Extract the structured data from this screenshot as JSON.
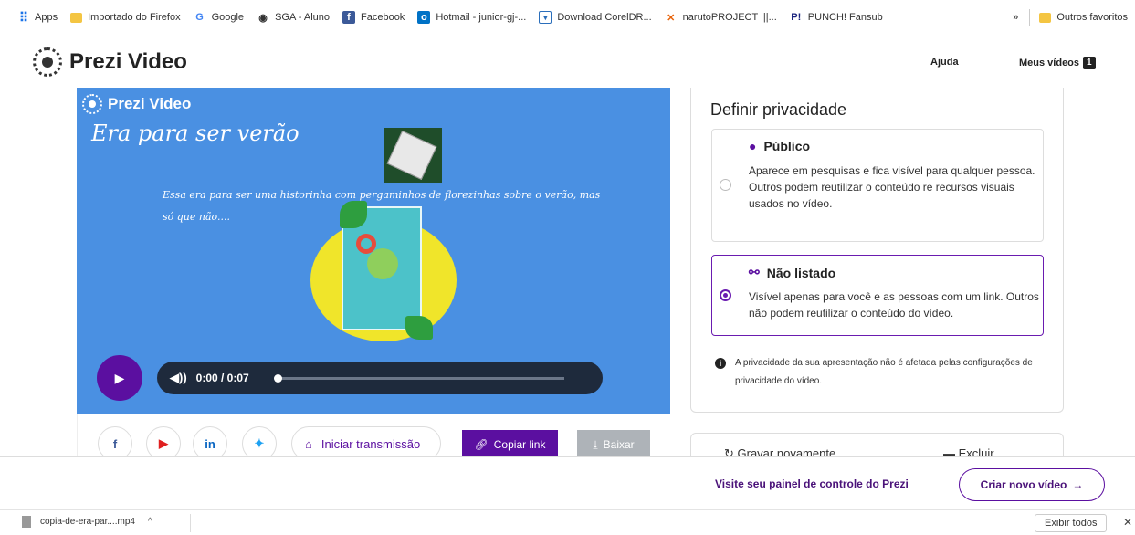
{
  "bookmarks": {
    "items": [
      {
        "label": "Apps",
        "icon": "apps-grid-icon"
      },
      {
        "label": "Importado do Firefox",
        "icon": "folder-icon"
      },
      {
        "label": "Google",
        "icon": "google-icon"
      },
      {
        "label": "SGA - Aluno",
        "icon": "globe-icon"
      },
      {
        "label": "Facebook",
        "icon": "facebook-icon"
      },
      {
        "label": "Hotmail - junior-gj-...",
        "icon": "outlook-icon"
      },
      {
        "label": "Download CorelDR...",
        "icon": "download-page-icon"
      },
      {
        "label": "narutoPROJECT |||...",
        "icon": "naruto-icon"
      },
      {
        "label": "PUNCH! Fansub",
        "icon": "punch-icon"
      }
    ],
    "more": "»",
    "other": "Outros favoritos"
  },
  "header": {
    "logo": "Prezi Video",
    "help": "Ajuda",
    "my_videos": "Meus vídeos",
    "my_videos_count": "1"
  },
  "video": {
    "logo": "Prezi Video",
    "title": "Era para ser verão",
    "text": "Essa era para ser uma historinha com pergaminhos de florezinhas sobre o verão, mas só que não....",
    "time": "0:00 / 0:07",
    "progress": 0
  },
  "share": {
    "stream_label": "Iniciar transmissão",
    "copy_label": "Copiar link",
    "download_label": "Baixar"
  },
  "privacy": {
    "title": "Definir privacidade",
    "options": [
      {
        "title": "Público",
        "desc": "Aparece em pesquisas e fica visível para qualquer pessoa.\nOutros podem reutilizar o conteúdo re recursos visuais usados no vídeo.",
        "selected": false
      },
      {
        "title": "Não listado",
        "desc": "Visível apenas para você e as pessoas com um link. Outros não podem reutilizar o conteúdo do vídeo.",
        "selected": true
      }
    ],
    "note": "A privacidade da sua apresentação não é afetada pelas configurações de privacidade do vídeo."
  },
  "actions": {
    "record_again": "Gravar novamente",
    "delete": "Excluir"
  },
  "footer": {
    "dashboard_link": "Visite seu painel de controle do Prezi",
    "new_video": "Criar novo vídeo"
  },
  "downloads": {
    "file": "copia-de-era-par....mp4",
    "show_all": "Exibir todos"
  },
  "colors": {
    "accent": "#5b0fa0",
    "video_bg": "#4a90e2"
  }
}
